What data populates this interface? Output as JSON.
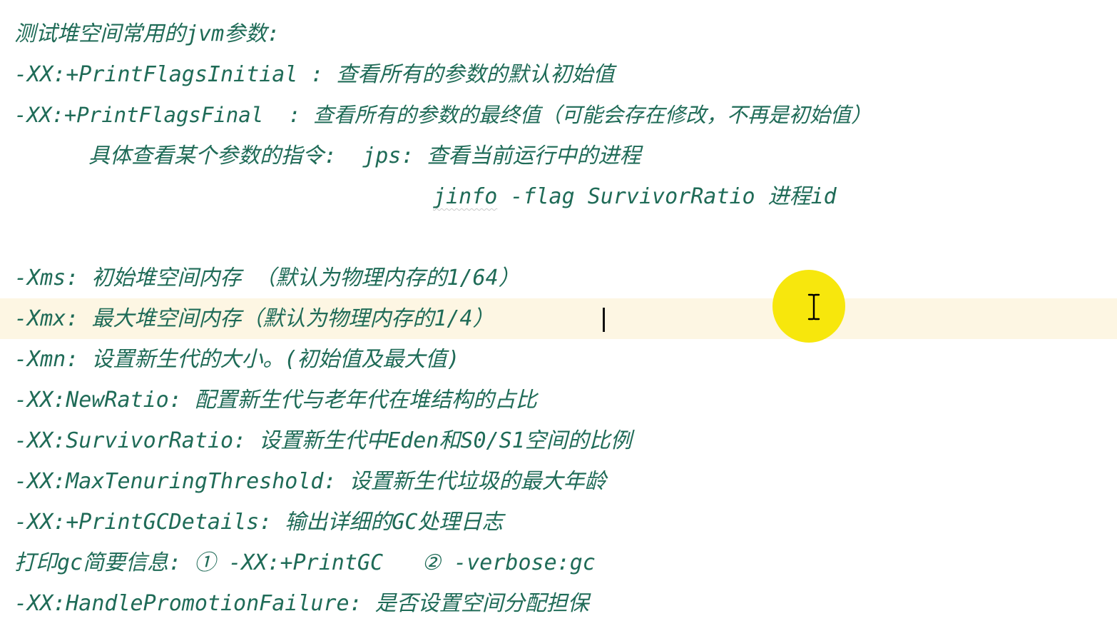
{
  "editor": {
    "lines": {
      "l0": "测试堆空间常用的jvm参数:",
      "l1": "-XX:+PrintFlagsInitial : 查看所有的参数的默认初始值",
      "l2": "-XX:+PrintFlagsFinal  : 查看所有的参数的最终值（可能会存在修改，不再是初始值）",
      "l3_indent": "    ",
      "l3": "具体查看某个参数的指令:  jps: 查看当前运行中的进程",
      "l4_cmd": "jinfo",
      "l4_rest": " -flag SurvivorRatio 进程id",
      "l5": "",
      "l6": "-Xms: 初始堆空间内存 （默认为物理内存的1/64）",
      "l7": "-Xmx: 最大堆空间内存（默认为物理内存的1/4）",
      "l8": "-Xmn: 设置新生代的大小。(初始值及最大值)",
      "l9": "-XX:NewRatio: 配置新生代与老年代在堆结构的占比",
      "l10": "-XX:SurvivorRatio: 设置新生代中Eden和S0/S1空间的比例",
      "l11": "-XX:MaxTenuringThreshold: 设置新生代垃圾的最大年龄",
      "l12": "-XX:+PrintGCDetails: 输出详细的GC处理日志",
      "l13": "打印gc简要信息: ① -XX:+PrintGC   ② -verbose:gc",
      "l14": "-XX:HandlePromotionFailure: 是否设置空间分配担保"
    },
    "text_color": "#1f6b57",
    "current_line_color": "#fdf6e3",
    "cursor_highlight_color": "#f7e600",
    "pointer_icon": "ibeam-cursor-icon"
  }
}
